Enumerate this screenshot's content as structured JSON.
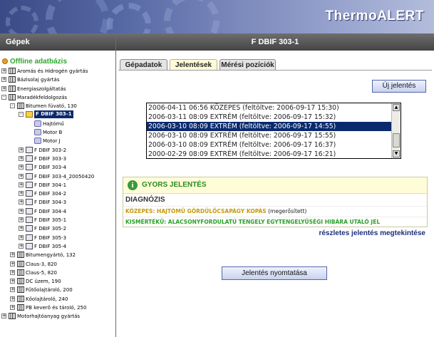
{
  "header": {
    "brand": "ThermoALERT"
  },
  "sidebar": {
    "title": "Gépek",
    "root_label": "Offline adatbázis",
    "items": [
      {
        "label": "Aromás és Hidrogén gyártás",
        "level": 0,
        "toggle": "+",
        "icon": "factory"
      },
      {
        "label": "Bázisolaj gyártás",
        "level": 0,
        "toggle": "+",
        "icon": "factory"
      },
      {
        "label": "Energiaszolgáltatás",
        "level": 0,
        "toggle": "+",
        "icon": "factory"
      },
      {
        "label": "Maradékfeldolgozás",
        "level": 0,
        "toggle": "-",
        "icon": "factory"
      },
      {
        "label": "Bitumen fúvató, 130",
        "level": 1,
        "toggle": "-",
        "icon": "factory"
      },
      {
        "label": "F DBIF 303-1",
        "level": 2,
        "toggle": "-",
        "icon": "machine-selected",
        "selected": true
      },
      {
        "label": "Hajtómű",
        "level": 3,
        "toggle": "",
        "icon": "motor"
      },
      {
        "label": "Motor B",
        "level": 3,
        "toggle": "",
        "icon": "motor"
      },
      {
        "label": "Motor J",
        "level": 3,
        "toggle": "",
        "icon": "motor"
      },
      {
        "label": "F DBIF 303-2",
        "level": 2,
        "toggle": "+",
        "icon": "machine"
      },
      {
        "label": "F DBIF 303-3",
        "level": 2,
        "toggle": "+",
        "icon": "machine"
      },
      {
        "label": "F DBIF 303-4",
        "level": 2,
        "toggle": "+",
        "icon": "machine"
      },
      {
        "label": "F DBIF 303-4_20050420",
        "level": 2,
        "toggle": "+",
        "icon": "machine"
      },
      {
        "label": "F DBIF 304-1",
        "level": 2,
        "toggle": "+",
        "icon": "machine"
      },
      {
        "label": "F DBIF 304-2",
        "level": 2,
        "toggle": "+",
        "icon": "machine"
      },
      {
        "label": "F DBIF 304-3",
        "level": 2,
        "toggle": "+",
        "icon": "machine"
      },
      {
        "label": "F DBIF 304-4",
        "level": 2,
        "toggle": "+",
        "icon": "machine"
      },
      {
        "label": "F DBIF 305-1",
        "level": 2,
        "toggle": "+",
        "icon": "machine"
      },
      {
        "label": "F DBIF 305-2",
        "level": 2,
        "toggle": "+",
        "icon": "machine"
      },
      {
        "label": "F DBIF 305-3",
        "level": 2,
        "toggle": "+",
        "icon": "machine"
      },
      {
        "label": "F DBIF 305-4",
        "level": 2,
        "toggle": "+",
        "icon": "machine"
      },
      {
        "label": "Bitumengyártó, 132",
        "level": 1,
        "toggle": "+",
        "icon": "factory"
      },
      {
        "label": "Claus-3, 820",
        "level": 1,
        "toggle": "+",
        "icon": "factory"
      },
      {
        "label": "Claus-5, 820",
        "level": 1,
        "toggle": "+",
        "icon": "factory"
      },
      {
        "label": "DC üzem, 190",
        "level": 1,
        "toggle": "+",
        "icon": "factory"
      },
      {
        "label": "Fűtőolajtároló, 200",
        "level": 1,
        "toggle": "+",
        "icon": "factory"
      },
      {
        "label": "Kőolajtároló, 240",
        "level": 1,
        "toggle": "+",
        "icon": "factory"
      },
      {
        "label": "PB keverő és tároló, 250",
        "level": 1,
        "toggle": "+",
        "icon": "factory"
      },
      {
        "label": "Motorhajtóanyag gyártás",
        "level": 0,
        "toggle": "+",
        "icon": "factory"
      }
    ]
  },
  "main": {
    "title": "F DBIF 303-1",
    "tabs": [
      {
        "label": "Gépadatok",
        "active": false
      },
      {
        "label": "Jelentések",
        "active": true
      },
      {
        "label": "Mérési pozíciók",
        "active": false
      }
    ],
    "new_report_label": "Új jelentés",
    "reports": [
      {
        "text": "2006-04-11 06:56 KÖZEPES (feltöltve: 2006-09-17 15:30)",
        "selected": false
      },
      {
        "text": "2006-03-11 08:09 EXTRÉM (feltöltve: 2006-09-17 15:32)",
        "selected": false
      },
      {
        "text": "2006-03-10 08:09 EXTRÉM (feltöltve: 2006-09-17 14:55)",
        "selected": true
      },
      {
        "text": "2006-03-10 08:09 EXTRÉM (feltöltve: 2006-09-17 15:55)",
        "selected": false
      },
      {
        "text": "2006-03-10 08:09 EXTRÉM (feltöltve: 2006-09-17 16:37)",
        "selected": false
      },
      {
        "text": "2000-02-29 08:09 EXTRÉM (feltöltve: 2006-09-17 16:21)",
        "selected": false
      }
    ],
    "quick_report": {
      "title": "GYORS JELENTÉS",
      "diagnosis_label": "DIAGNÓZIS",
      "line1_warning": "KÖZEPES: HAJTÓMŰ GÖRDÜLŐCSAPÁGY KOPÁS",
      "line1_confirmed": "(megerősített)",
      "line2": "KISMÉRTÉKŰ: ALACSONYFORDULATÚ TENGELY EGYTENGELYŰSÉGI HIBÁRA UTALÓ JEL"
    },
    "details_link": "részletes jelentés megtekintése",
    "print_label": "Jelentés nyomtatása"
  }
}
